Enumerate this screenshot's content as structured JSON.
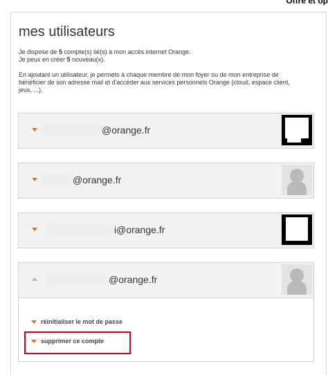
{
  "top_right_text": "Offre et op",
  "title": "mes utilisateurs",
  "intro": {
    "line1_prefix": "Je dispose de ",
    "line1_count": "5",
    "line1_suffix": " compte(s) lié(s) à mon accès internet Orange.",
    "line2_prefix": "Je peux en créer ",
    "line2_count": "5",
    "line2_suffix": " nouveau(x).",
    "paragraph": "En ajoutant un utilisateur, je permets à chaque membre de mon foyer ou de mon entreprise de bénéficier de son adresse mail et d'accéder aux services personnels Orange (cloud, espace client, jeux, ...)."
  },
  "accounts": [
    {
      "email": "@orange.fr",
      "avatar": "photo-avatar",
      "expanded": false
    },
    {
      "email": "@orange.fr",
      "avatar": "generic-user-avatar",
      "expanded": false
    },
    {
      "email": "i@orange.fr",
      "avatar": "photo-avatar",
      "expanded": false
    },
    {
      "email": "@orange.fr",
      "avatar": "generic-user-avatar",
      "expanded": true
    }
  ],
  "actions": {
    "reset_password": "réinitialiser le mot de passe",
    "delete_account": "supprimer ce compte"
  },
  "colors": {
    "accent": "#f16e00",
    "highlight": "#d0021b"
  }
}
